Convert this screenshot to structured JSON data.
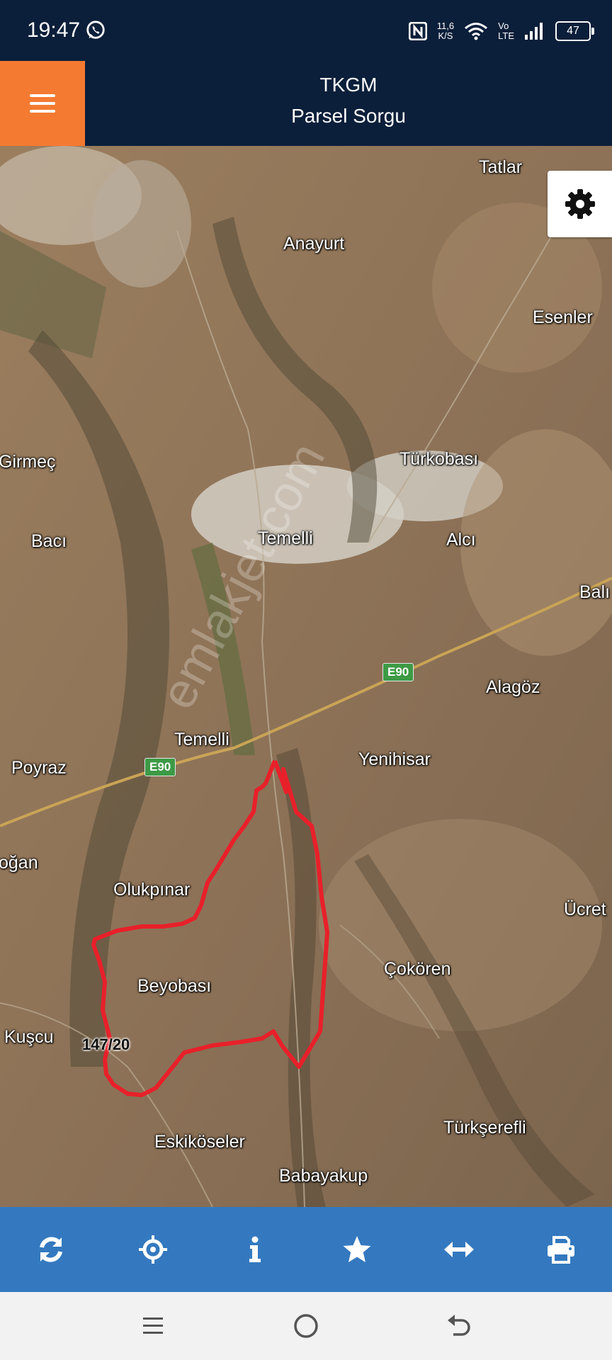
{
  "status_bar": {
    "time": "19:47",
    "net_speed_value": "11,6",
    "net_speed_unit": "K/S",
    "volte_top": "Vo",
    "volte_bottom": "LTE",
    "battery": "47"
  },
  "header": {
    "title": "TKGM",
    "subtitle": "Parsel Sorgu",
    "menu_color": "#f47a31",
    "bg_color": "#0b1f3a"
  },
  "map": {
    "places": [
      "Tatlar",
      "Anayurt",
      "Esenler",
      "Girmeç",
      "Türkobası",
      "Bacı",
      "Temelli",
      "Alcı",
      "Balı",
      "Alagöz",
      "Temelli",
      "Yenihisar",
      "Poyraz",
      "oğan",
      "Olukpınar",
      "Ücret",
      "Beyobası",
      "Çokören",
      "Kuşcu",
      "Türkşerefli",
      "Eskiköseler",
      "Babayakup"
    ],
    "roads": [
      "E90",
      "E90"
    ],
    "parcel_label": "147/20",
    "parcel_color": "#e8202a",
    "watermark": "emlakjet.com"
  },
  "toolbar": {
    "bg_color": "#3479bf",
    "icons": [
      "refresh-icon",
      "locate-icon",
      "info-icon",
      "star-icon",
      "measure-icon",
      "print-icon"
    ]
  },
  "navbar": {
    "icons": [
      "recent-apps-icon",
      "home-icon",
      "back-icon"
    ]
  }
}
